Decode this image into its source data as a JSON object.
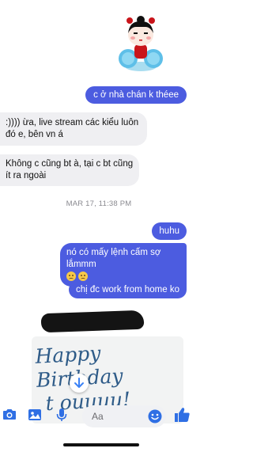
{
  "conversation": {
    "messages": [
      {
        "sender": "me",
        "text": "c ở nhà chán k théee"
      },
      {
        "sender": "them",
        "text": ":)))) ừa, live stream các kiểu luôn đó e, bên vn á"
      },
      {
        "sender": "them",
        "text": "Không c cũng bt à, tại c bt cũng ít ra ngoài"
      },
      {
        "sender": "me",
        "text": "huhu"
      },
      {
        "sender": "me",
        "text": "nó có mấy lệnh cấm sợ lắmmm"
      },
      {
        "sender": "me",
        "text": "chị đc work from home ko"
      }
    ],
    "timestamp": "MAR 17, 11:38 PM",
    "card": {
      "line1": "Happy Birthday",
      "line2": "t  ouuuu!"
    }
  },
  "composer": {
    "placeholder": "Aa"
  },
  "icons": {
    "camera": "camera-icon",
    "gallery": "gallery-icon",
    "mic": "mic-icon",
    "emoji": "emoji-icon",
    "like": "thumbs-up-icon",
    "scroll": "arrow-down-icon"
  },
  "colors": {
    "accent": "#4c5ce0",
    "incoming_bubble": "#efeff2",
    "card_text": "#2e5b88"
  }
}
